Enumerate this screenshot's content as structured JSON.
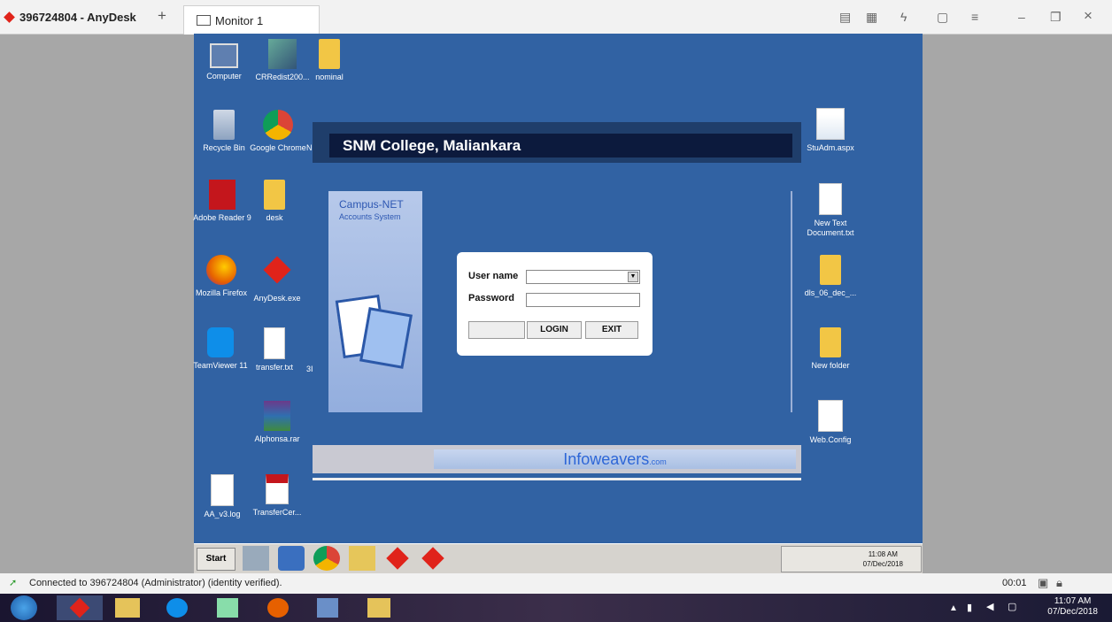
{
  "anydesk": {
    "session_tab": "396724804 - AnyDesk",
    "plus": "+",
    "monitor_tab": "Monitor 1",
    "window_controls": {
      "min": "–",
      "max": "❐",
      "close": "×"
    }
  },
  "desktop_icons": {
    "computer": "Computer",
    "crredist": "CRRedist200...",
    "nominal": "nominal",
    "recycle": "Recycle Bin",
    "chrome": "Google Chrome",
    "chrome_partial": "N",
    "adobe": "Adobe Reader 9",
    "desk": "desk",
    "firefox": "Mozilla Firefox",
    "anydesk_exe": "AnyDesk.exe",
    "teamviewer": "TeamViewer 11",
    "transfer": "transfer.txt",
    "transfer_partial": "3I",
    "alphonsa": "Alphonsa.rar",
    "aa_log": "AA_v3.log",
    "transfercer": "TransferCer...",
    "stuadm": "StuAdm.aspx",
    "newtext": "New Text Document.txt",
    "dls": "dls_06_dec_...",
    "newfolder": "New folder",
    "webconfig": "Web.Config"
  },
  "app": {
    "college": "SNM College, Maliankara",
    "side_title": "Campus-NET",
    "side_sub": "Accounts System",
    "username_label": "User name",
    "password_label": "Password",
    "login_btn": "LOGIN",
    "exit_btn": "EXIT",
    "footer_brand": "Infoweavers",
    "footer_suffix": ".com"
  },
  "remote_taskbar": {
    "start": "Start",
    "clock_time": "11:08 AM",
    "clock_date": "07/Dec/2018"
  },
  "status": {
    "connection": "Connected to 396724804 (Administrator) (identity verified).",
    "timer": "00:01"
  },
  "host_taskbar": {
    "clock_time": "11:07 AM",
    "clock_date": "07/Dec/2018"
  }
}
